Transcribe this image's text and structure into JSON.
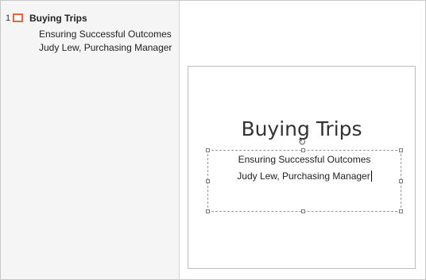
{
  "outline": {
    "slides": [
      {
        "number": "1",
        "title": "Buying Trips",
        "lines": [
          "Ensuring Successful Outcomes",
          "Judy Lew, Purchasing Manager"
        ]
      }
    ]
  },
  "slide": {
    "title": "Buying Trips",
    "subtitle_line1": "Ensuring Successful Outcomes",
    "subtitle_line2": "Judy Lew, Purchasing Manager"
  },
  "colors": {
    "slide_icon_border": "#e8643c",
    "outline_background": "#f5f5f5"
  }
}
